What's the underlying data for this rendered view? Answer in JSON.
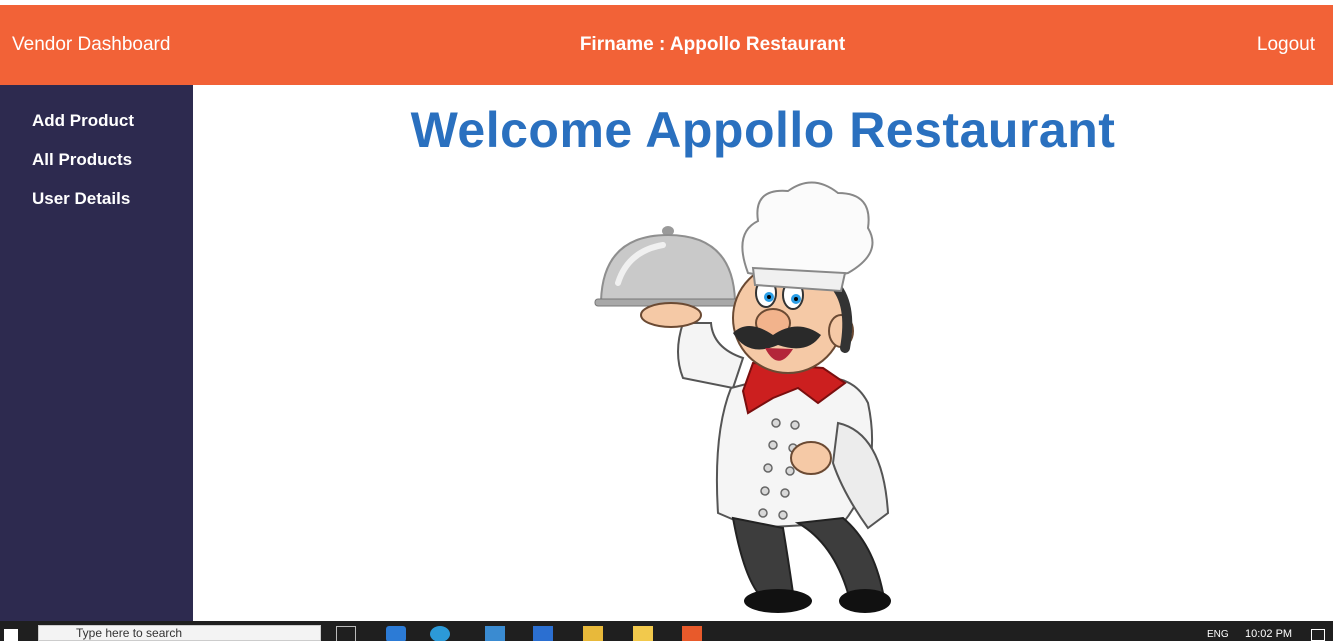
{
  "navbar": {
    "brand": "Vendor Dashboard",
    "firm": "Firname : Appollo Restaurant",
    "logout": "Logout"
  },
  "sidebar": {
    "items": [
      {
        "label": "Add Product"
      },
      {
        "label": "All Products"
      },
      {
        "label": "User Details"
      }
    ]
  },
  "main": {
    "welcome": "Welcome Appollo Restaurant"
  },
  "taskbar": {
    "search_placeholder": "Type here to search",
    "lang": "ENG",
    "time": "10:02 PM"
  },
  "colors": {
    "navbar": "#f26237",
    "sidebar": "#2d2a4f",
    "welcome": "#2a70bf"
  }
}
